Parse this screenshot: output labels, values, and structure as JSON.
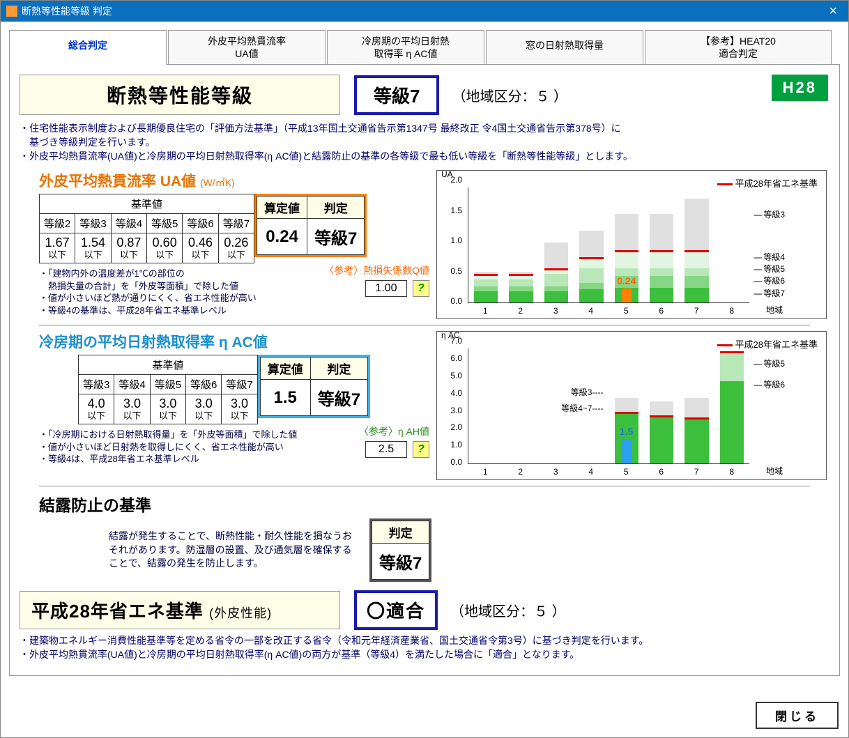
{
  "window": {
    "title": "断熱等性能等級 判定"
  },
  "tabs": [
    "総合判定",
    "外皮平均熱貫流率\nUA値",
    "冷房期の平均日射熱\n取得率 η AC値",
    "窓の日射熱取得量",
    "【参考】HEAT20\n適合判定"
  ],
  "summary": {
    "title": "断熱等性能等級",
    "grade": "等級7",
    "zone": "（地域区分：５ ）",
    "h28_badge": "H28",
    "desc1": "・住宅性能表示制度および長期優良住宅の「評価方法基準」（平成13年国土交通省告示第1347号 最終改正 令4国土交通省告示第378号）に\n　基づき等級判定を行います。",
    "desc2": "・外皮平均熱貫流率(UA値)と冷房期の平均日射熱取得率(η AC値)と結露防止の基準の各等級で最も低い等級を「断熱等性能等級」とします。"
  },
  "ua": {
    "title": "外皮平均熱貫流率 UA値",
    "unit": "(W/㎡K)",
    "std_header": "基準値",
    "grades": [
      "等級2",
      "等級3",
      "等級4",
      "等級5",
      "等級6",
      "等級7"
    ],
    "values": [
      "1.67\n以下",
      "1.54\n以下",
      "0.87\n以下",
      "0.60\n以下",
      "0.46\n以下",
      "0.26\n以下"
    ],
    "calc_header": "算定値",
    "judge_header": "判定",
    "calc_value": "0.24",
    "judge_value": "等級7",
    "notes": "・「建物内外の温度差が1℃の部位の\n　熱損失量の合計」を「外皮等面積」で除した値\n・値が小さいほど熱が通りにくく、省エネ性能が高い\n・等級4の基準は、平成28年省エネ基準レベル",
    "ref_label": "〈参考〉熱損失係数Q値",
    "ref_value": "1.00"
  },
  "ac": {
    "title": "冷房期の平均日射熱取得率  η AC値",
    "std_header": "基準値",
    "grades": [
      "等級3",
      "等級4",
      "等級5",
      "等級6",
      "等級7"
    ],
    "values": [
      "4.0\n以下",
      "3.0\n以下",
      "3.0\n以下",
      "3.0\n以下",
      "3.0\n以下"
    ],
    "calc_header": "算定値",
    "judge_header": "判定",
    "calc_value": "1.5",
    "judge_value": "等級7",
    "notes": "・「冷房期における日射熱取得量」を「外皮等面積」で除した値\n・値が小さいほど日射熱を取得しにくく、省エネ性能が高い\n・等級4は、平成28年省エネ基準レベル",
    "ref_label": "〈参考〉η AH値",
    "ref_value": "2.5"
  },
  "ketsuro": {
    "title": "結露防止の基準",
    "notes": "結露が発生することで、断熱性能・耐久性能を損なうおそれがあります。防湿層の設置、及び通気層を確保することで、結露の発生を防止します。",
    "judge_header": "判定",
    "judge_value": "等級7"
  },
  "h28": {
    "title": "平成28年省エネ基準",
    "sub": "(外皮性能)",
    "conform": "〇適合",
    "zone": "（地域区分：５ ）",
    "desc1": "・建築物エネルギー消費性能基準等を定める省令の一部を改正する省令（令和元年経済産業省、国土交通省令第3号）に基づき判定を行います。",
    "desc2": "・外皮平均熱貫流率(UA値)と冷房期の平均日射熱取得率(η AC値)の両方が基準（等級4）を満たした場合に「適合」となります。"
  },
  "chart_data": [
    {
      "type": "bar",
      "name": "UA",
      "title": "UA",
      "legend": "平成28年省エネ基準",
      "x": [
        "1",
        "2",
        "3",
        "4",
        "5",
        "6",
        "7",
        "8"
      ],
      "ylabel": "UA",
      "xlabel": "地域",
      "ylim": [
        0,
        2.0
      ],
      "yticks": [
        "0.0",
        "0.5",
        "1.0",
        "1.5",
        "2.0"
      ],
      "series": [
        {
          "name": "等級7",
          "values": [
            0.2,
            0.2,
            0.2,
            0.23,
            0.26,
            0.26,
            0.26,
            null
          ]
        },
        {
          "name": "等級6",
          "values": [
            0.28,
            0.28,
            0.28,
            0.34,
            0.46,
            0.46,
            0.46,
            null
          ]
        },
        {
          "name": "等級5",
          "values": [
            0.4,
            0.4,
            0.5,
            0.6,
            0.6,
            0.6,
            0.6,
            null
          ]
        },
        {
          "name": "等級4",
          "values": [
            0.46,
            0.46,
            0.56,
            0.75,
            0.87,
            0.87,
            0.87,
            null
          ]
        },
        {
          "name": "等級3",
          "values": [
            0.54,
            0.54,
            1.04,
            1.25,
            1.54,
            1.54,
            1.81,
            null
          ]
        }
      ],
      "h28_line": [
        0.46,
        0.46,
        0.56,
        0.75,
        0.87,
        0.87,
        0.87,
        null
      ],
      "marker": {
        "x": "5",
        "value": 0.24,
        "label": "0.24",
        "color": "#ff8000"
      },
      "side_labels": [
        "等級3",
        "等級4",
        "等級5",
        "等級6",
        "等級7"
      ]
    },
    {
      "type": "bar",
      "name": "ηAC",
      "title": "η AC",
      "legend": "平成28年省エネ基準",
      "x": [
        "1",
        "2",
        "3",
        "4",
        "5",
        "6",
        "7",
        "8"
      ],
      "ylabel": "η AC",
      "xlabel": "地域",
      "ylim": [
        0,
        7.0
      ],
      "yticks": [
        "0.0",
        "1.0",
        "2.0",
        "3.0",
        "4.0",
        "5.0",
        "6.0",
        "7.0"
      ],
      "series": [
        {
          "name": "等級5/6/7",
          "values": [
            null,
            null,
            null,
            null,
            3.0,
            2.8,
            2.7,
            5.0
          ]
        },
        {
          "name": "等級4",
          "values": [
            null,
            null,
            null,
            null,
            3.0,
            2.8,
            2.7,
            6.7
          ]
        },
        {
          "name": "等級3",
          "values": [
            null,
            null,
            null,
            null,
            4.0,
            3.8,
            4.0,
            null
          ]
        }
      ],
      "h28_line": [
        null,
        null,
        null,
        null,
        3.0,
        2.8,
        2.7,
        6.7
      ],
      "marker": {
        "x": "5",
        "value": 1.5,
        "label": "1.5",
        "color": "#2aa0f0"
      },
      "left_labels": {
        "等級3": [
          5,
          4.0
        ],
        "等級4~7": [
          5,
          3.0
        ]
      },
      "side_labels": [
        "等級5",
        "等級6"
      ]
    }
  ],
  "close": "閉じる"
}
